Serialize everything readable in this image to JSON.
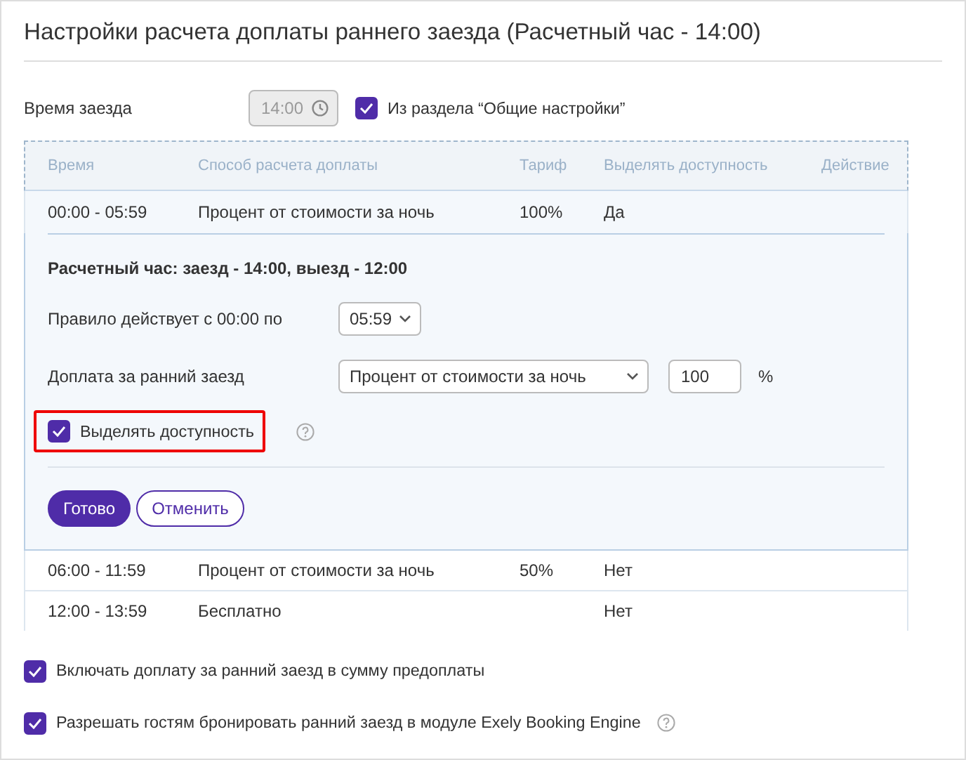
{
  "title": "Настройки расчета доплаты раннего заезда (Расчетный час - 14:00)",
  "check_in": {
    "label": "Время заезда",
    "time": "14:00",
    "disabled": true,
    "from_general": {
      "label": "Из раздела “Общие настройки”",
      "checked": true
    }
  },
  "table": {
    "columns": [
      "Время",
      "Способ расчета доплаты",
      "Тариф",
      "Выделять доступность",
      "Действие"
    ],
    "rows": [
      {
        "time": "00:00 - 05:59",
        "method": "Процент от стоимости за ночь",
        "tariff": "100%",
        "availability": "Да",
        "expanded": true
      },
      {
        "time": "06:00 - 11:59",
        "method": "Процент от стоимости за ночь",
        "tariff": "50%",
        "availability": "Нет",
        "expanded": false
      },
      {
        "time": "12:00 - 13:59",
        "method": "Бесплатно",
        "tariff": "",
        "availability": "Нет",
        "expanded": false
      }
    ]
  },
  "editor": {
    "heading": "Расчетный час: заезд - 14:00, выезд - 12:00",
    "rule_label": "Правило действует с 00:00 по",
    "rule_time": "05:59",
    "fee_label": "Доплата за ранний заезд",
    "fee_method": "Процент от стоимости за ночь",
    "fee_value": "100",
    "fee_unit": "%",
    "availability": {
      "label": "Выделять доступность",
      "checked": true,
      "highlighted": true
    },
    "buttons": [
      {
        "label": "Готово",
        "kind": "primary"
      },
      {
        "label": "Отменить",
        "kind": "secondary"
      }
    ]
  },
  "options": [
    {
      "label": "Включать доплату за ранний заезд в сумму предоплаты",
      "checked": true,
      "help": false
    },
    {
      "label": "Разрешать гостям бронировать ранний заезд в модуле Exely Booking Engine",
      "checked": true,
      "help": true
    }
  ]
}
